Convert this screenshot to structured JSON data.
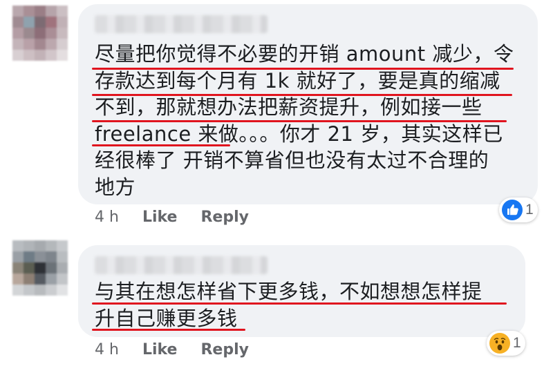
{
  "comments": [
    {
      "text_lines": [
        "尽量把你觉得不必要的开销 amount 减少，令",
        "存款达到每个月有 1k 就好了，要是真的缩减",
        "不到，那就想办法把薪资提升，例如接一些",
        "freelance 来做。。。你才 21 岁，其实这样已",
        "经很棒了 开销不算省但也没有太过不合理的",
        "地方"
      ],
      "time": "4 h",
      "like_label": "Like",
      "reply_label": "Reply",
      "reaction": {
        "type": "like",
        "icon": "thumbs-up-icon",
        "count": "1",
        "color": "#1877f2"
      }
    },
    {
      "text_lines": [
        "与其在想怎样省下更多钱，不如想想怎样提",
        "升自己赚更多钱"
      ],
      "time": "4 h",
      "like_label": "Like",
      "reply_label": "Reply",
      "reaction": {
        "type": "wow",
        "icon": "wow-face-icon",
        "count": "1",
        "color": "#f7b125"
      }
    }
  ],
  "colors": {
    "underline": "#e0141e",
    "bubble": "#f0f2f5",
    "meta_text": "#65676b"
  }
}
